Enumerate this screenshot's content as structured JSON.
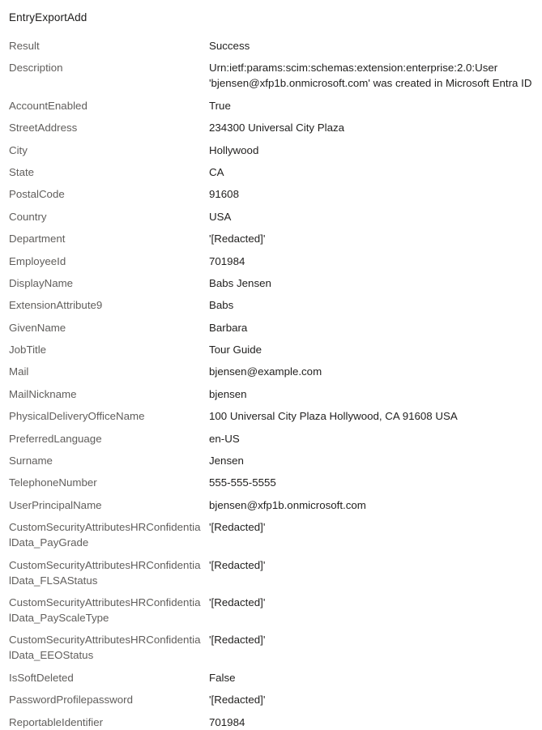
{
  "panel": {
    "title": "EntryExportAdd",
    "properties": [
      {
        "label": "Result",
        "value": "Success"
      },
      {
        "label": "Description",
        "value": "Urn:ietf:params:scim:schemas:extension:enterprise:2.0:User\n'bjensen@xfp1b.onmicrosoft.com' was created in Microsoft Entra ID"
      },
      {
        "label": "AccountEnabled",
        "value": "True"
      },
      {
        "label": "StreetAddress",
        "value": "234300 Universal City Plaza"
      },
      {
        "label": "City",
        "value": "Hollywood"
      },
      {
        "label": "State",
        "value": "CA"
      },
      {
        "label": "PostalCode",
        "value": "91608"
      },
      {
        "label": "Country",
        "value": "USA"
      },
      {
        "label": "Department",
        "value": "'[Redacted]'"
      },
      {
        "label": "EmployeeId",
        "value": "701984"
      },
      {
        "label": "DisplayName",
        "value": "Babs Jensen"
      },
      {
        "label": "ExtensionAttribute9",
        "value": "Babs"
      },
      {
        "label": "GivenName",
        "value": "Barbara"
      },
      {
        "label": "JobTitle",
        "value": "Tour Guide"
      },
      {
        "label": "Mail",
        "value": "bjensen@example.com"
      },
      {
        "label": "MailNickname",
        "value": "bjensen"
      },
      {
        "label": "PhysicalDeliveryOfficeName",
        "value": "100 Universal City Plaza Hollywood, CA 91608 USA"
      },
      {
        "label": "PreferredLanguage",
        "value": "en-US"
      },
      {
        "label": "Surname",
        "value": "Jensen"
      },
      {
        "label": "TelephoneNumber",
        "value": "555-555-5555"
      },
      {
        "label": "UserPrincipalName",
        "value": "bjensen@xfp1b.onmicrosoft.com"
      },
      {
        "label": "CustomSecurityAttributesHRConfidentialData_PayGrade",
        "value": "'[Redacted]'"
      },
      {
        "label": "CustomSecurityAttributesHRConfidentialData_FLSAStatus",
        "value": "'[Redacted]'"
      },
      {
        "label": "CustomSecurityAttributesHRConfidentialData_PayScaleType",
        "value": "'[Redacted]'"
      },
      {
        "label": "CustomSecurityAttributesHRConfidentialData_EEOStatus",
        "value": "'[Redacted]'"
      },
      {
        "label": "IsSoftDeleted",
        "value": "False"
      },
      {
        "label": "PasswordProfilepassword",
        "value": "'[Redacted]'"
      },
      {
        "label": "ReportableIdentifier",
        "value": "701984"
      }
    ]
  },
  "colors": {
    "label_text": "#605e5c",
    "value_text": "#201f1e",
    "title_text": "#1b1a19",
    "background": "#ffffff"
  }
}
